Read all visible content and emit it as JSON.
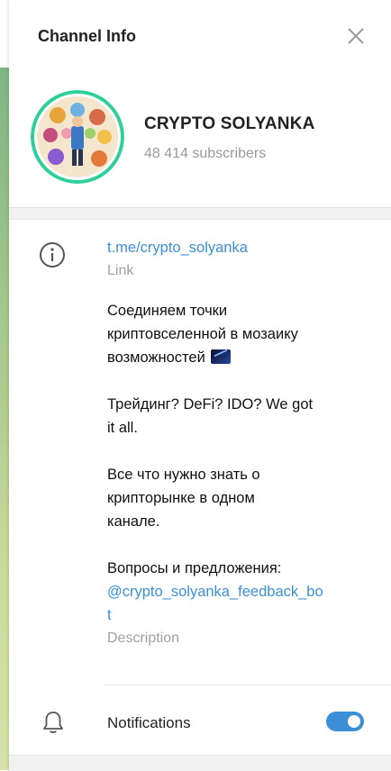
{
  "header": {
    "title": "Channel Info",
    "close_icon": "close-icon"
  },
  "profile": {
    "name": "CRYPTO SOLYANKA",
    "subscribers": "48 414 subscribers",
    "avatar_ring_color": "#2fcf9a"
  },
  "info": {
    "icon": "info-icon",
    "link": "t.me/crypto_solyanka",
    "link_caption": "Link",
    "description": {
      "line1": "Соединяем точки",
      "line2": "криптовселенной в мозаику",
      "line3": "возможностей",
      "emoji": "chart-emoji",
      "para2_line1": "Трейдинг? DeFi? IDO? We got",
      "para2_line2": "it all.",
      "para3_line1": "Все что нужно знать о",
      "para3_line2": "крипторынке в одном",
      "para3_line3": "канале.",
      "para4_line1": "Вопросы и предложения:",
      "para4_link_line1": "@crypto_solyanka_feedback_bo",
      "para4_link_line2": "t"
    },
    "description_caption": "Description"
  },
  "notifications": {
    "icon": "bell-icon",
    "label": "Notifications",
    "enabled": true
  },
  "colors": {
    "link": "#3a8fd6",
    "toggle_on": "#3a8fd6",
    "caption": "#a0a0a0"
  }
}
